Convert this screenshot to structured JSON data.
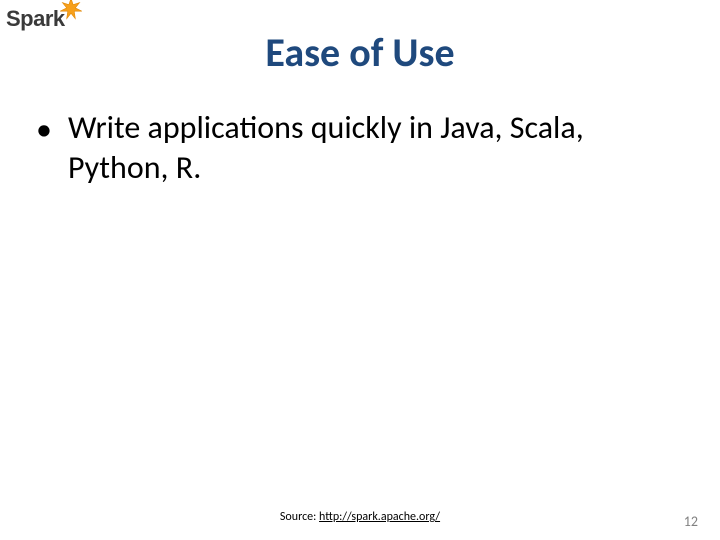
{
  "logo": {
    "text": "Spark"
  },
  "title": "Ease of Use",
  "bullets": [
    "Write applications quickly in Java, Scala, Python, R."
  ],
  "source": {
    "label": "Source: ",
    "link_text": "http://spark.apache.org/"
  },
  "page_number": "12"
}
